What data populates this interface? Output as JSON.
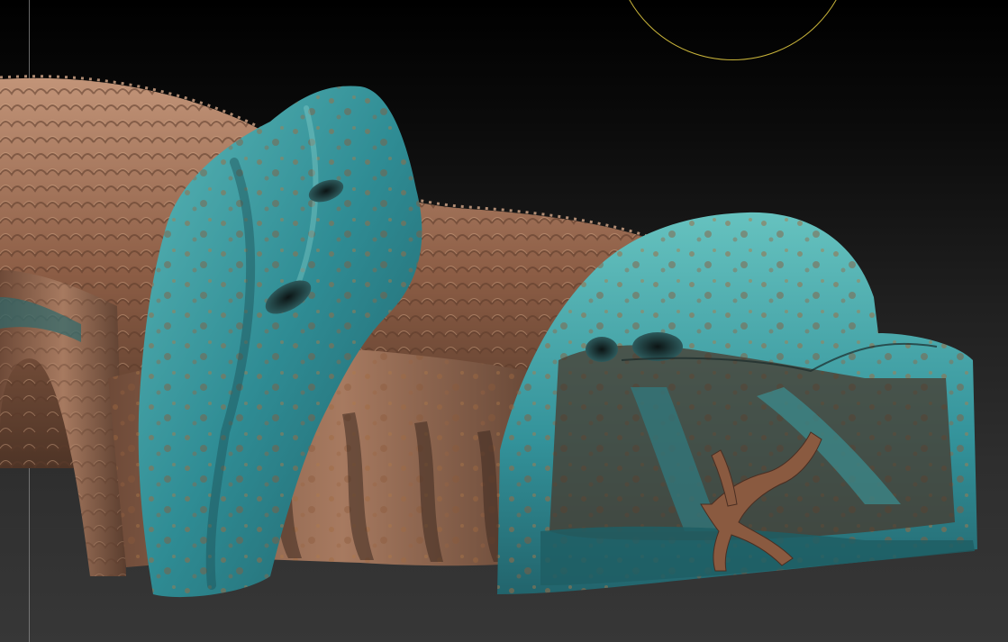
{
  "viewport": {
    "background_top": "#000000",
    "background_bottom": "#373737",
    "brush_cursor_color": "#c9b43a",
    "guide_line_color": "#8a8a8a"
  },
  "model": {
    "rock_color": "#8a5c44",
    "rock_highlight": "#c09070",
    "patina_color": "#3c9a9e",
    "patina_highlight": "#6cc4c2",
    "rust_spot_color": "#b0703a"
  }
}
